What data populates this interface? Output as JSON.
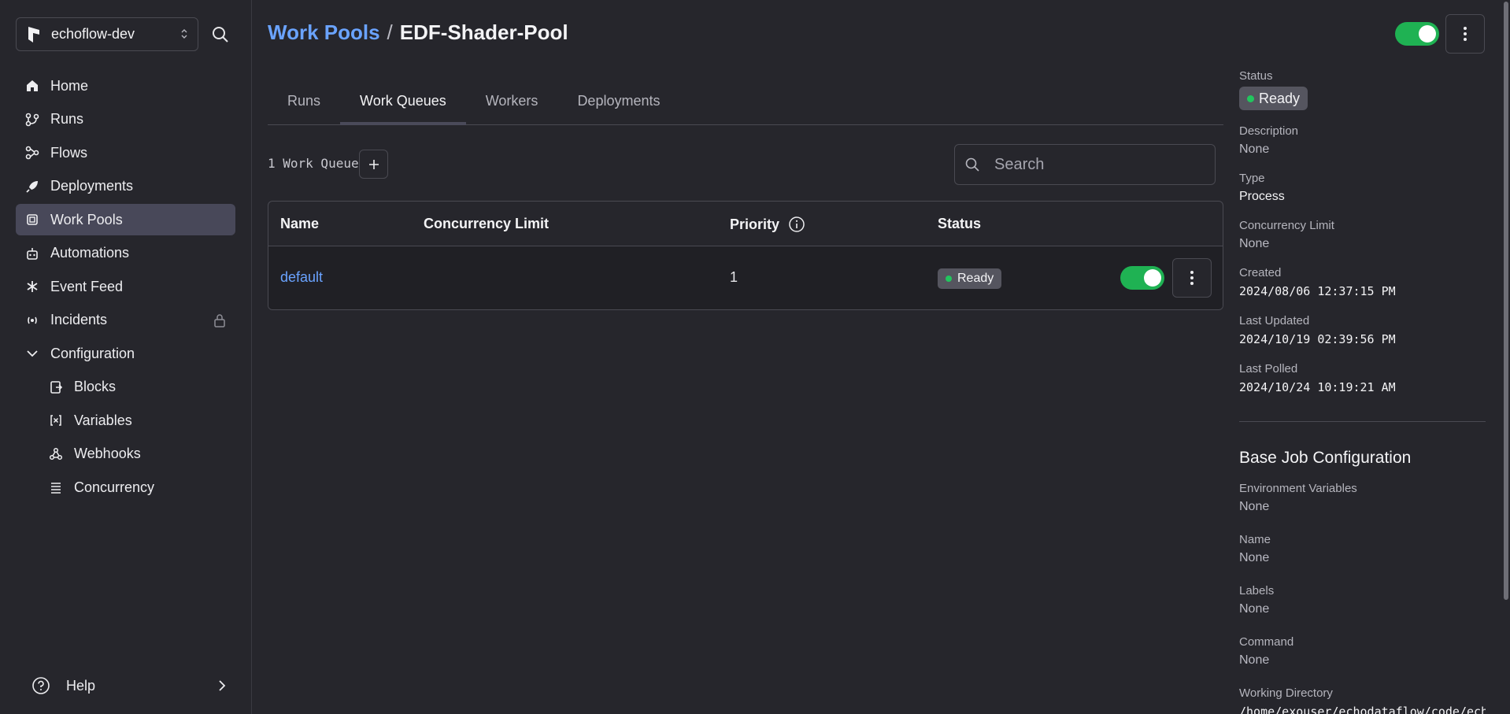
{
  "workspace": {
    "name": "echoflow-dev"
  },
  "sidebar": {
    "items": [
      {
        "label": "Home",
        "icon": "home-icon"
      },
      {
        "label": "Runs",
        "icon": "runs-icon"
      },
      {
        "label": "Flows",
        "icon": "flows-icon"
      },
      {
        "label": "Deployments",
        "icon": "rocket-icon"
      },
      {
        "label": "Work Pools",
        "icon": "cpu-icon",
        "active": true
      },
      {
        "label": "Automations",
        "icon": "robot-icon"
      },
      {
        "label": "Event Feed",
        "icon": "asterisk-icon"
      },
      {
        "label": "Incidents",
        "icon": "incident-icon"
      },
      {
        "label": "Configuration",
        "icon": "chevron-down-icon"
      }
    ],
    "config_items": [
      {
        "label": "Blocks",
        "icon": "blocks-icon"
      },
      {
        "label": "Variables",
        "icon": "variables-icon"
      },
      {
        "label": "Webhooks",
        "icon": "webhook-icon"
      },
      {
        "label": "Concurrency",
        "icon": "concurrency-icon"
      }
    ],
    "help": "Help"
  },
  "header": {
    "breadcrumb_parent": "Work Pools",
    "separator": "/",
    "title": "EDF-Shader-Pool",
    "enabled": true
  },
  "tabs": [
    {
      "label": "Runs"
    },
    {
      "label": "Work Queues",
      "active": true
    },
    {
      "label": "Workers"
    },
    {
      "label": "Deployments"
    }
  ],
  "queues": {
    "count_label": "1 Work Queue",
    "search_placeholder": "Search",
    "columns": [
      "Name",
      "Concurrency Limit",
      "Priority",
      "Status"
    ],
    "rows": [
      {
        "name": "default",
        "concurrency_limit": "",
        "priority": "1",
        "status": "Ready",
        "enabled": true
      }
    ]
  },
  "details": {
    "status_label": "Status",
    "status_value": "Ready",
    "description_label": "Description",
    "description_value": "None",
    "type_label": "Type",
    "type_value": "Process",
    "concurrency_label": "Concurrency Limit",
    "concurrency_value": "None",
    "created_label": "Created",
    "created_value": "2024/08/06 12:37:15 PM",
    "updated_label": "Last Updated",
    "updated_value": "2024/10/19 02:39:56 PM",
    "polled_label": "Last Polled",
    "polled_value": "2024/10/24 10:19:21 AM",
    "base_job_title": "Base Job Configuration",
    "env_label": "Environment Variables",
    "env_value": "None",
    "name_label": "Name",
    "name_value": "None",
    "labels_label": "Labels",
    "labels_value": "None",
    "command_label": "Command",
    "command_value": "None",
    "workdir_label": "Working Directory",
    "workdir_value": "/home/exouser/echodataflow/code/echodat"
  },
  "colors": {
    "accent": "#6aa3ff",
    "toggle_on": "#1fb253",
    "ready_dot": "#22c55e",
    "background": "#26262c"
  }
}
